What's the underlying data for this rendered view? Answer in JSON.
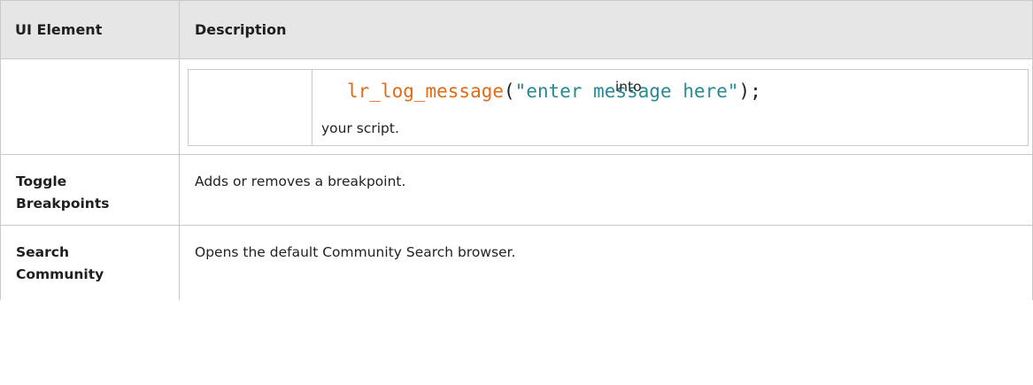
{
  "header": {
    "col_ui_element": "UI Element",
    "col_description": "Description"
  },
  "rows": [
    {
      "name": "",
      "code": {
        "function": "lr_log_message",
        "open_paren": "(",
        "string": "\"enter message here\"",
        "close": ");"
      },
      "after_code": "into",
      "continuation": "your script."
    },
    {
      "name_line1": "Toggle",
      "name_line2": "Breakpoints",
      "description": "Adds or removes a breakpoint."
    },
    {
      "name_line1": "Search",
      "name_line2": "Community",
      "description": "Opens the default Community Search browser."
    }
  ],
  "colors": {
    "header_bg": "#e6e6e6",
    "border": "#c9c9c9",
    "code_function": "#e26b17",
    "code_string": "#2a8a93"
  }
}
